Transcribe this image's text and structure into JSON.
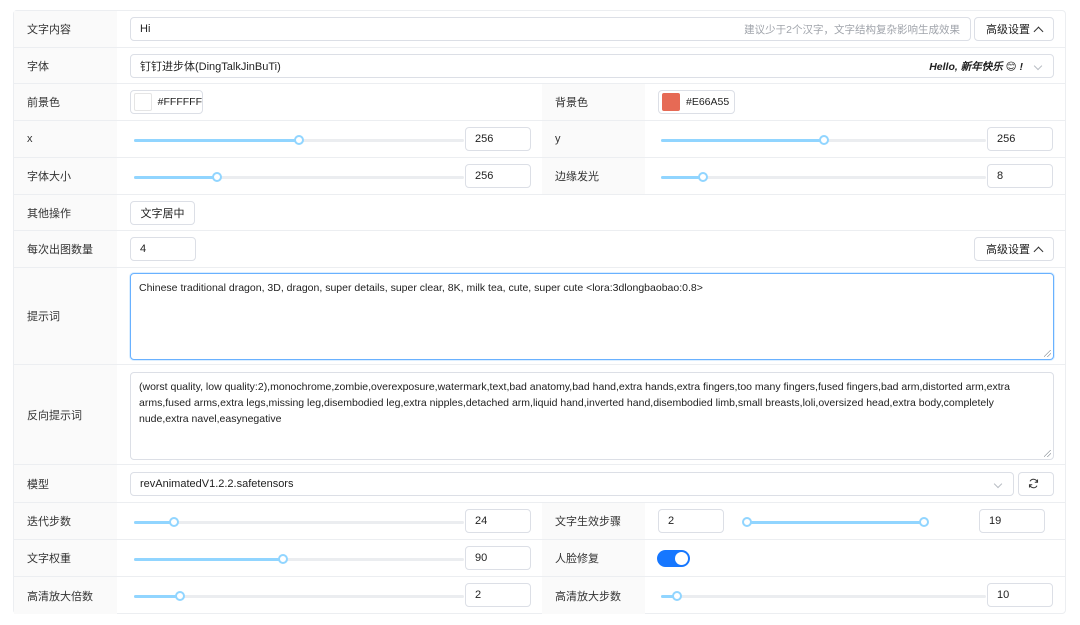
{
  "text_content": {
    "label": "文字内容",
    "value": "Hi",
    "hint": "建议少于2个汉字，文字结构复杂影响生成效果",
    "advanced_label": "高级设置"
  },
  "font": {
    "label": "字体",
    "value": "钉钉进步体(DingTalkJinBuTi)",
    "preview": "Hello, 新年快乐 😊 !"
  },
  "foreground": {
    "label": "前景色",
    "value": "#FFFFFF",
    "color": "#FFFFFF"
  },
  "background": {
    "label": "背景色",
    "value": "#E66A55",
    "color": "#E66A55"
  },
  "x": {
    "label": "x",
    "value": "256",
    "level": 0.5
  },
  "y": {
    "label": "y",
    "value": "256",
    "level": 0.5
  },
  "font_size": {
    "label": "字体大小",
    "value": "256",
    "level": 0.25
  },
  "edge_glow": {
    "label": "边缘发光",
    "value": "8",
    "level": 0.13
  },
  "other_ops": {
    "label": "其他操作",
    "center_button": "文字居中"
  },
  "batch_count": {
    "label": "每次出图数量",
    "value": "4",
    "advanced_label": "高级设置"
  },
  "prompt": {
    "label": "提示词",
    "value": "Chinese traditional dragon, 3D, dragon, super details, super clear, 8K, milk tea, cute, super cute <lora:3dlongbaobao:0.8>"
  },
  "negative_prompt": {
    "label": "反向提示词",
    "value": "(worst quality, low quality:2),monochrome,zombie,overexposure,watermark,text,bad anatomy,bad hand,extra hands,extra fingers,too many fingers,fused fingers,bad arm,distorted arm,extra arms,fused arms,extra legs,missing leg,disembodied leg,extra nipples,detached arm,liquid hand,inverted hand,disembodied limb,small breasts,loli,oversized head,extra body,completely nude,extra navel,easynegative"
  },
  "model": {
    "label": "模型",
    "value": "revAnimatedV1.2.2.safetensors"
  },
  "steps": {
    "label": "迭代步数",
    "value": "24",
    "level": 0.12
  },
  "text_steps": {
    "label": "文字生效步骤",
    "start": "2",
    "end": "19",
    "start_level": 0.0,
    "end_level": 1.0
  },
  "text_weight": {
    "label": "文字权重",
    "value": "90",
    "level": 0.45
  },
  "face_fix": {
    "label": "人脸修复",
    "enabled": true
  },
  "hires_scale": {
    "label": "高清放大倍数",
    "value": "2",
    "level": 0.14
  },
  "hires_steps": {
    "label": "高清放大步数",
    "value": "10",
    "level": 0.05
  },
  "colors": {
    "accent": "#1677ff",
    "slider": "#91d5ff",
    "border": "#dcdfe6"
  }
}
